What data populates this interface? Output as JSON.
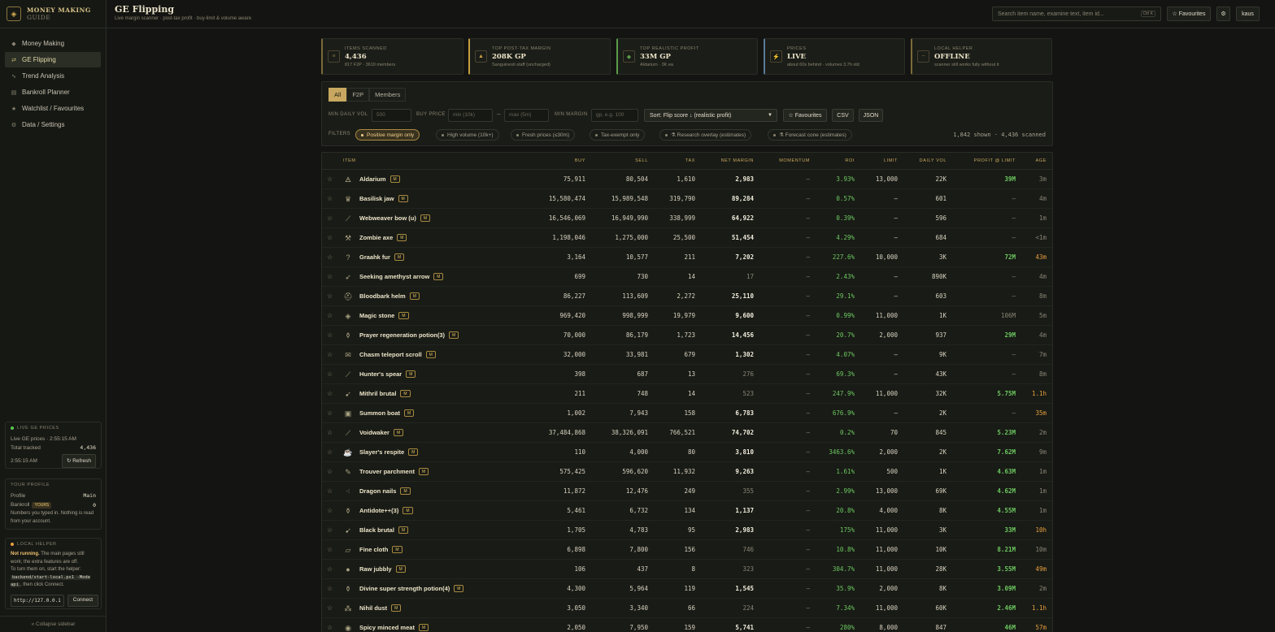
{
  "brand": {
    "line1": "MONEY MAKING",
    "line2": "GUIDE",
    "logo": "◈"
  },
  "nav": [
    {
      "label": "Money Making",
      "icon": "◆",
      "active": false
    },
    {
      "label": "GE Flipping",
      "icon": "⇄",
      "active": true
    },
    {
      "label": "Trend Analysis",
      "icon": "∿",
      "active": false
    },
    {
      "label": "Bankroll Planner",
      "icon": "▤",
      "active": false
    },
    {
      "label": "Watchlist / Favourites",
      "icon": "★",
      "active": false
    },
    {
      "label": "Data / Settings",
      "icon": "⚙",
      "active": false
    }
  ],
  "live_prices": {
    "caption": "LIVE GE PRICES",
    "line": "Live GE prices · 2:55:15 AM",
    "tracked_label": "Total tracked",
    "tracked_value": "4,436",
    "time": "2:55:15 AM",
    "refresh": "↻ Refresh"
  },
  "profile": {
    "caption": "YOUR PROFILE",
    "profile_label": "Profile",
    "profile_value": "Main",
    "bankroll_label": "Bankroll",
    "bankroll_tag": "YOURS",
    "bankroll_value": "0",
    "note": "Numbers you typed in. Nothing is read from your account."
  },
  "local_helper": {
    "caption": "LOCAL HELPER",
    "status": "Not running.",
    "text1": "The main pages still work; the extra features are off.",
    "text2": "To turn them on, start the helper:",
    "command": "backend/start-local.ps1 -Mode api",
    "text3": ", then click Connect.",
    "url": "http://127.0.0.1",
    "connect": "Connect"
  },
  "collapse": "« Collapse sidebar",
  "header": {
    "title": "GE Flipping",
    "subtitle": "Live margin scanner · post-tax profit · buy-limit & volume aware",
    "search_placeholder": "Search item name, examine text, item id...",
    "search_kbd": "Ctrl K",
    "favourites": "☆ Favourites",
    "settings_icon": "⚙",
    "user": "kaus"
  },
  "stats": [
    {
      "label": "ITEMS SCANNED",
      "value": "4,436",
      "note": "817 F2P · 3619 members",
      "icon": "≡",
      "color": "#7a6a38"
    },
    {
      "label": "TOP POST-TAX MARGIN",
      "value": "208K GP",
      "note": "Sanguinesti staff (uncharged)",
      "icon": "▲",
      "color": "#c8a040"
    },
    {
      "label": "TOP REALISTIC PROFIT",
      "value": "33M GP",
      "note": "Aldarium · 3K ea",
      "icon": "◆",
      "color": "#5a9a48"
    },
    {
      "label": "PRICES",
      "value": "LIVE",
      "note": "about 60s behind · volumes 3.7h old",
      "icon": "⚡",
      "color": "#5a7a98"
    },
    {
      "label": "LOCAL HELPER",
      "value": "OFFLINE",
      "note": "scanner still works fully without it",
      "icon": "~",
      "color": "#7a6a38"
    }
  ],
  "filters": {
    "segments": [
      "All",
      "F2P",
      "Members"
    ],
    "min_daily_vol_label": "MIN DAILY VOL",
    "min_daily_vol_placeholder": "500",
    "buy_price_label": "BUY PRICE",
    "buy_min_placeholder": "min (10k)",
    "dash": "–",
    "buy_max_placeholder": "max (5m)",
    "min_margin_label": "MIN MARGIN",
    "min_margin_placeholder": "gp, e.g. 100",
    "sort": "Sort: Flip score ↓ (realistic profit)",
    "favourites": "☆ Favourites",
    "csv": "CSV",
    "json": "JSON",
    "filters_label": "FILTERS",
    "chips": [
      {
        "label": "Positive margin only",
        "active": true
      },
      {
        "label": "High volume (10k+)",
        "active": false
      },
      {
        "label": "Fresh prices (≤30m)",
        "active": false
      },
      {
        "label": "Tax-exempt only",
        "active": false
      },
      {
        "label": "⚗ Research overlay (estimates)",
        "active": false
      },
      {
        "label": "⚗ Forecast cone (estimates)",
        "active": false
      }
    ],
    "shown": "1,842 shown · 4,436 scanned"
  },
  "table": {
    "headers": {
      "item": "ITEM",
      "buy": "BUY",
      "sell": "SELL",
      "tax": "TAX",
      "net_margin": "NET MARGIN",
      "momentum": "MOMENTUM",
      "roi": "ROI",
      "limit": "LIMIT",
      "daily_vol": "DAILY VOL",
      "profit": "PROFIT @ LIMIT",
      "age": "AGE"
    },
    "badge": "M",
    "rows": [
      {
        "name": "Aldarium",
        "icon": "🜁",
        "buy": "75,911",
        "sell": "80,504",
        "tax": "1,610",
        "margin": "2,983",
        "strong": true,
        "mom": "–",
        "roi": "3.93%",
        "limit": "13,000",
        "vol": "22K",
        "profit": "39M",
        "age": "3m",
        "old": false
      },
      {
        "name": "Basilisk jaw",
        "icon": "♛",
        "buy": "15,580,474",
        "sell": "15,989,548",
        "tax": "319,790",
        "margin": "89,284",
        "strong": true,
        "mom": "–",
        "roi": "0.57%",
        "limit": "–",
        "vol": "601",
        "profit": "–",
        "age": "4m",
        "old": false
      },
      {
        "name": "Webweaver bow (u)",
        "icon": "⟋",
        "buy": "16,546,069",
        "sell": "16,949,990",
        "tax": "338,999",
        "margin": "64,922",
        "strong": true,
        "mom": "–",
        "roi": "0.39%",
        "limit": "–",
        "vol": "596",
        "profit": "–",
        "age": "1m",
        "old": false
      },
      {
        "name": "Zombie axe",
        "icon": "⚒",
        "buy": "1,198,046",
        "sell": "1,275,000",
        "tax": "25,500",
        "margin": "51,454",
        "strong": true,
        "mom": "–",
        "roi": "4.29%",
        "limit": "–",
        "vol": "684",
        "profit": "–",
        "age": "<1m",
        "old": false
      },
      {
        "name": "Graahk fur",
        "icon": "?",
        "buy": "3,164",
        "sell": "10,577",
        "tax": "211",
        "margin": "7,202",
        "strong": true,
        "mom": "–",
        "roi": "227.6%",
        "limit": "10,000",
        "vol": "3K",
        "profit": "72M",
        "age": "43m",
        "old": true
      },
      {
        "name": "Seeking amethyst arrow",
        "icon": "➶",
        "buy": "699",
        "sell": "730",
        "tax": "14",
        "margin": "17",
        "strong": false,
        "mom": "–",
        "roi": "2.43%",
        "limit": "–",
        "vol": "890K",
        "profit": "–",
        "age": "4m",
        "old": false
      },
      {
        "name": "Bloodbark helm",
        "icon": "⛑",
        "buy": "86,227",
        "sell": "113,609",
        "tax": "2,272",
        "margin": "25,110",
        "strong": true,
        "mom": "–",
        "roi": "29.1%",
        "limit": "–",
        "vol": "603",
        "profit": "–",
        "age": "8m",
        "old": false
      },
      {
        "name": "Magic stone",
        "icon": "◈",
        "buy": "969,420",
        "sell": "998,999",
        "tax": "19,979",
        "margin": "9,600",
        "strong": true,
        "mom": "–",
        "roi": "0.99%",
        "limit": "11,000",
        "vol": "1K",
        "profit": "106M",
        "age": "5m",
        "old": false,
        "dimprofit": true
      },
      {
        "name": "Prayer regeneration potion(3)",
        "icon": "⚱",
        "buy": "70,000",
        "sell": "86,179",
        "tax": "1,723",
        "margin": "14,456",
        "strong": true,
        "mom": "–",
        "roi": "20.7%",
        "limit": "2,000",
        "vol": "937",
        "profit": "29M",
        "age": "4m",
        "old": false
      },
      {
        "name": "Chasm teleport scroll",
        "icon": "✉",
        "buy": "32,000",
        "sell": "33,981",
        "tax": "679",
        "margin": "1,302",
        "strong": true,
        "mom": "–",
        "roi": "4.07%",
        "limit": "–",
        "vol": "9K",
        "profit": "–",
        "age": "7m",
        "old": false
      },
      {
        "name": "Hunter's spear",
        "icon": "⟋",
        "buy": "398",
        "sell": "687",
        "tax": "13",
        "margin": "276",
        "strong": false,
        "mom": "–",
        "roi": "69.3%",
        "limit": "–",
        "vol": "43K",
        "profit": "–",
        "age": "8m",
        "old": false
      },
      {
        "name": "Mithril brutal",
        "icon": "➹",
        "buy": "211",
        "sell": "748",
        "tax": "14",
        "margin": "523",
        "strong": false,
        "mom": "–",
        "roi": "247.9%",
        "limit": "11,000",
        "vol": "32K",
        "profit": "5.75M",
        "age": "1.1h",
        "old": true
      },
      {
        "name": "Summon boat",
        "icon": "▣",
        "buy": "1,002",
        "sell": "7,943",
        "tax": "158",
        "margin": "6,783",
        "strong": true,
        "mom": "–",
        "roi": "676.9%",
        "limit": "–",
        "vol": "2K",
        "profit": "–",
        "age": "35m",
        "old": true
      },
      {
        "name": "Voidwaker",
        "icon": "⟋",
        "buy": "37,484,868",
        "sell": "38,326,091",
        "tax": "766,521",
        "margin": "74,702",
        "strong": true,
        "mom": "–",
        "roi": "0.2%",
        "limit": "70",
        "vol": "845",
        "profit": "5.23M",
        "age": "2m",
        "old": false
      },
      {
        "name": "Slayer's respite",
        "icon": "☕",
        "buy": "110",
        "sell": "4,000",
        "tax": "80",
        "margin": "3,810",
        "strong": true,
        "mom": "–",
        "roi": "3463.6%",
        "limit": "2,000",
        "vol": "2K",
        "profit": "7.62M",
        "age": "9m",
        "old": false
      },
      {
        "name": "Trouver parchment",
        "icon": "✎",
        "buy": "575,425",
        "sell": "596,620",
        "tax": "11,932",
        "margin": "9,263",
        "strong": true,
        "mom": "–",
        "roi": "1.61%",
        "limit": "500",
        "vol": "1K",
        "profit": "4.63M",
        "age": "1m",
        "old": false
      },
      {
        "name": "Dragon nails",
        "icon": "⁖",
        "buy": "11,872",
        "sell": "12,476",
        "tax": "249",
        "margin": "355",
        "strong": false,
        "mom": "–",
        "roi": "2.99%",
        "limit": "13,000",
        "vol": "69K",
        "profit": "4.62M",
        "age": "1m",
        "old": false
      },
      {
        "name": "Antidote++(3)",
        "icon": "⚱",
        "buy": "5,461",
        "sell": "6,732",
        "tax": "134",
        "margin": "1,137",
        "strong": true,
        "mom": "–",
        "roi": "20.8%",
        "limit": "4,000",
        "vol": "8K",
        "profit": "4.55M",
        "age": "1m",
        "old": false
      },
      {
        "name": "Black brutal",
        "icon": "➹",
        "buy": "1,705",
        "sell": "4,783",
        "tax": "95",
        "margin": "2,983",
        "strong": true,
        "mom": "–",
        "roi": "175%",
        "limit": "11,000",
        "vol": "3K",
        "profit": "33M",
        "age": "10h",
        "old": true
      },
      {
        "name": "Fine cloth",
        "icon": "▱",
        "buy": "6,898",
        "sell": "7,800",
        "tax": "156",
        "margin": "746",
        "strong": false,
        "mom": "–",
        "roi": "10.8%",
        "limit": "11,000",
        "vol": "10K",
        "profit": "8.21M",
        "age": "10m",
        "old": false
      },
      {
        "name": "Raw jubbly",
        "icon": "●",
        "buy": "106",
        "sell": "437",
        "tax": "8",
        "margin": "323",
        "strong": false,
        "mom": "–",
        "roi": "304.7%",
        "limit": "11,000",
        "vol": "28K",
        "profit": "3.55M",
        "age": "49m",
        "old": true
      },
      {
        "name": "Divine super strength potion(4)",
        "icon": "⚱",
        "buy": "4,300",
        "sell": "5,964",
        "tax": "119",
        "margin": "1,545",
        "strong": true,
        "mom": "–",
        "roi": "35.9%",
        "limit": "2,000",
        "vol": "8K",
        "profit": "3.09M",
        "age": "2m",
        "old": false
      },
      {
        "name": "Nihil dust",
        "icon": "⁂",
        "buy": "3,050",
        "sell": "3,340",
        "tax": "66",
        "margin": "224",
        "strong": false,
        "mom": "–",
        "roi": "7.34%",
        "limit": "11,000",
        "vol": "60K",
        "profit": "2.46M",
        "age": "1.1h",
        "old": true
      },
      {
        "name": "Spicy minced meat",
        "icon": "◉",
        "buy": "2,050",
        "sell": "7,950",
        "tax": "159",
        "margin": "5,741",
        "strong": true,
        "mom": "–",
        "roi": "280%",
        "limit": "8,000",
        "vol": "847",
        "profit": "46M",
        "age": "57m",
        "old": true
      }
    ]
  }
}
